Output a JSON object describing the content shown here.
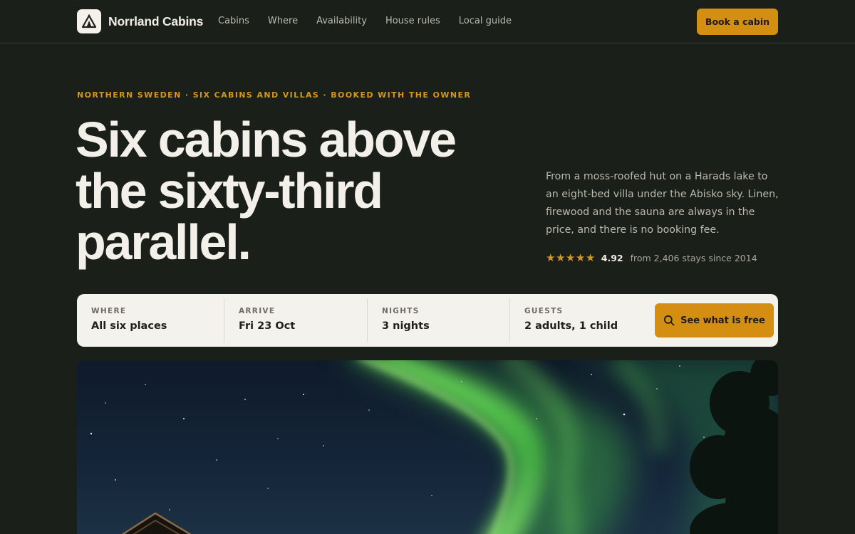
{
  "header": {
    "brand": "Norrland Cabins",
    "logo_icon": "tent-triangle-icon",
    "nav": [
      "Cabins",
      "Where",
      "Availability",
      "House rules",
      "Local guide"
    ],
    "cta": "Book a cabin"
  },
  "hero": {
    "eyebrow": "NORTHERN SWEDEN · SIX CABINS AND VILLAS · BOOKED WITH THE OWNER",
    "title": "Six cabins above the sixty-third parallel.",
    "copy": "From a moss-roofed hut on a Harads lake to an eight-bed villa under the Abisko sky. Linen, firewood and the sauna are always in the price, and there is no booking fee.",
    "rating": {
      "stars": 5,
      "score": "4.92",
      "note": "from 2,406 stays since 2014"
    }
  },
  "search": {
    "where": {
      "label": "WHERE",
      "value": "All six places"
    },
    "arrive": {
      "label": "ARRIVE",
      "value": "Fri 23 Oct"
    },
    "nights": {
      "label": "NIGHTS",
      "value": "3 nights"
    },
    "guests": {
      "label": "GUESTS",
      "value": "2 adults, 1 child"
    },
    "button": "See what is free",
    "button_icon": "search-icon"
  },
  "photo": {
    "subject_icon": "aurora-night-sky-photo"
  },
  "colors": {
    "background": "#1a1f19",
    "accent": "#d48f12",
    "eyebrow": "#d4961d",
    "search_surface": "#f4f2ec"
  }
}
